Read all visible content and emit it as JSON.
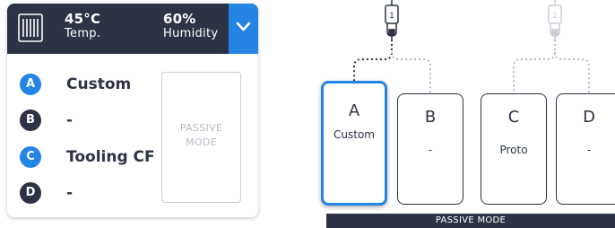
{
  "status_panel": {
    "temperature_value": "45°C",
    "temperature_label": "Temp.",
    "humidity_value": "60%",
    "humidity_label": "Humidity",
    "dropdown_icon": "chevron-down-icon",
    "heater_icon": "heater-icon",
    "slots": [
      {
        "letter": "A",
        "material": "Custom",
        "loaded": true
      },
      {
        "letter": "B",
        "material": "-",
        "loaded": false
      },
      {
        "letter": "C",
        "material": "Tooling CF",
        "loaded": true
      },
      {
        "letter": "D",
        "material": "-",
        "loaded": false
      }
    ],
    "passive_mode_label": "PASSIVE MODE"
  },
  "diagram": {
    "extruders": [
      {
        "number": "1",
        "active": true
      },
      {
        "number": "2",
        "active": false
      }
    ],
    "slots": [
      {
        "letter": "A",
        "material": "Custom",
        "active": true
      },
      {
        "letter": "B",
        "material": "-",
        "active": false
      },
      {
        "letter": "C",
        "material": "Proto",
        "active": false
      },
      {
        "letter": "D",
        "material": "-",
        "active": false
      }
    ],
    "passive_mode_label": "PASSIVE MODE"
  },
  "colors": {
    "dark_navy": "#2b3344",
    "accent_blue": "#2585e4",
    "muted_gray": "#b5bcc6"
  }
}
